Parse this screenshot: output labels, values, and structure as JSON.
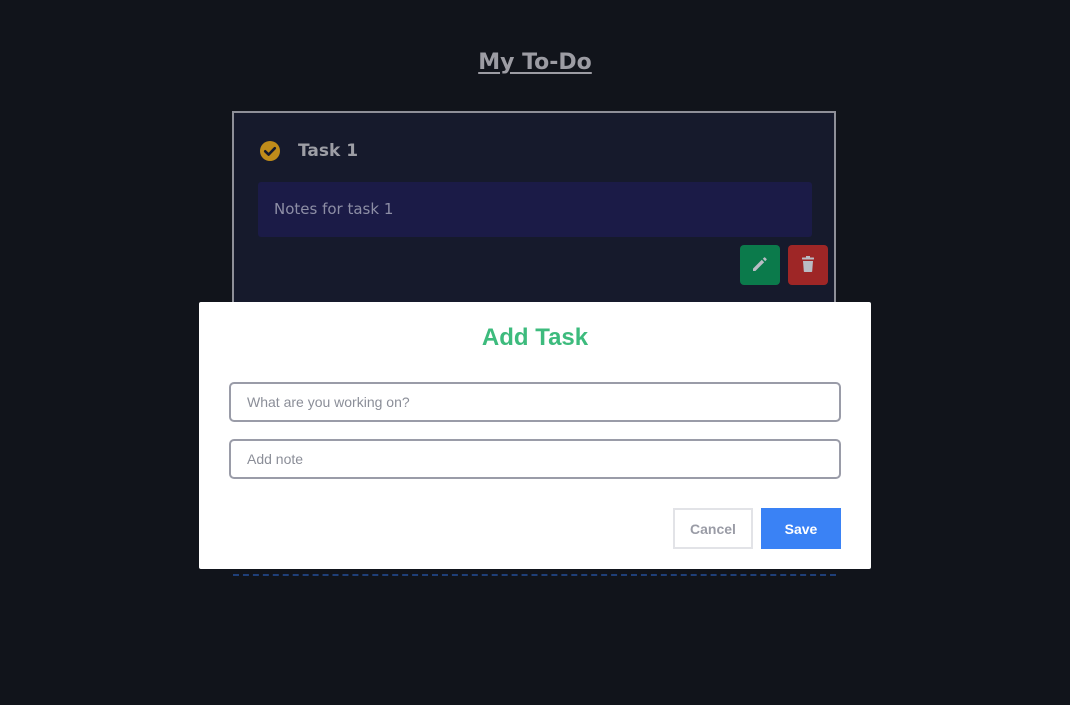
{
  "app": {
    "title": "My To-Do"
  },
  "tasks": [
    {
      "title": "Task 1",
      "notes": "Notes for task 1",
      "completed": true
    }
  ],
  "modal": {
    "title": "Add Task",
    "task_input": {
      "placeholder": "What are you working on?",
      "value": ""
    },
    "note_input": {
      "placeholder": "Add note",
      "value": ""
    },
    "cancel_label": "Cancel",
    "save_label": "Save"
  },
  "icons": {
    "check": "check-circle-icon",
    "edit": "pencil-icon",
    "delete": "trash-icon"
  },
  "colors": {
    "background": "#11141b",
    "card": "#161a2c",
    "notes": "#1b1b47",
    "check": "#c08c1a",
    "edit": "#0b7a4b",
    "delete": "#9e2626",
    "accent": "#3dbb7d",
    "save": "#3a82f5"
  }
}
